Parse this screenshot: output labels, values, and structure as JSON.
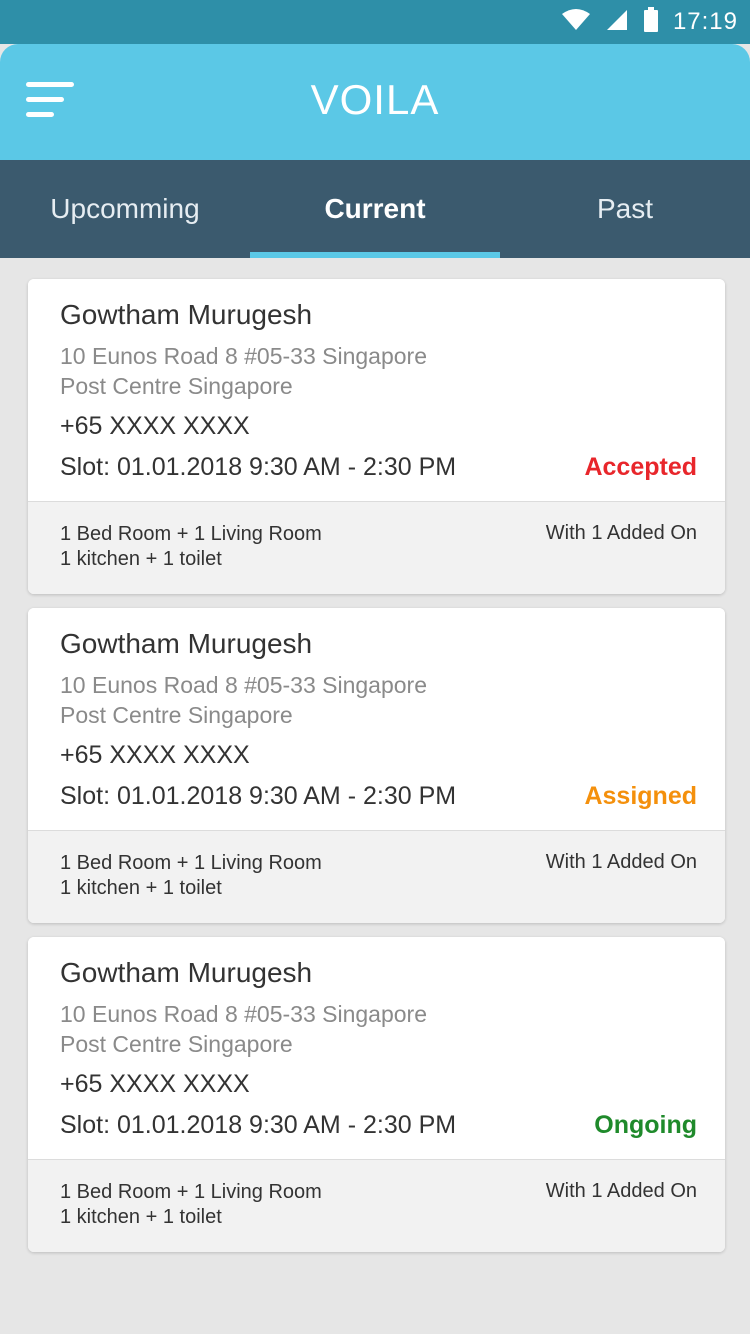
{
  "status_bar": {
    "time": "17:19",
    "icons": [
      "wifi-icon",
      "signal-icon",
      "battery-icon"
    ]
  },
  "app_bar": {
    "title": "VOILA",
    "menu_icon": "menu-icon"
  },
  "tabs": [
    {
      "label": "Upcomming",
      "active": false
    },
    {
      "label": "Current",
      "active": true
    },
    {
      "label": "Past",
      "active": false
    }
  ],
  "colors": {
    "app_bar": "#5bc8e6",
    "status_bar": "#2e8fa8",
    "tab_bar": "#3b5a6e",
    "accepted": "#e8262b",
    "assigned": "#f4900c",
    "ongoing": "#1f8a2b"
  },
  "bookings": [
    {
      "name": "Gowtham Murugesh",
      "address_line1": "10 Eunos Road 8 #05-33 Singapore",
      "address_line2": "Post Centre Singapore",
      "phone": "+65 XXXX XXXX",
      "slot": "Slot: 01.01.2018 9:30 AM - 2:30 PM",
      "status": "Accepted",
      "status_color": "#e8262b",
      "rooms_line1": "1 Bed Room + 1 Living Room",
      "rooms_line2": "1 kitchen + 1 toilet",
      "addon": "With 1 Added On"
    },
    {
      "name": "Gowtham Murugesh",
      "address_line1": "10 Eunos Road 8 #05-33 Singapore",
      "address_line2": "Post Centre Singapore",
      "phone": "+65 XXXX XXXX",
      "slot": "Slot: 01.01.2018 9:30 AM - 2:30 PM",
      "status": "Assigned",
      "status_color": "#f4900c",
      "rooms_line1": "1 Bed Room + 1 Living Room",
      "rooms_line2": "1 kitchen + 1 toilet",
      "addon": "With 1 Added On"
    },
    {
      "name": "Gowtham Murugesh",
      "address_line1": "10 Eunos Road 8 #05-33 Singapore",
      "address_line2": "Post Centre Singapore",
      "phone": "+65 XXXX XXXX",
      "slot": "Slot: 01.01.2018 9:30 AM - 2:30 PM",
      "status": "Ongoing",
      "status_color": "#1f8a2b",
      "rooms_line1": "1 Bed Room + 1 Living Room",
      "rooms_line2": "1 kitchen + 1 toilet",
      "addon": "With 1 Added On"
    }
  ]
}
